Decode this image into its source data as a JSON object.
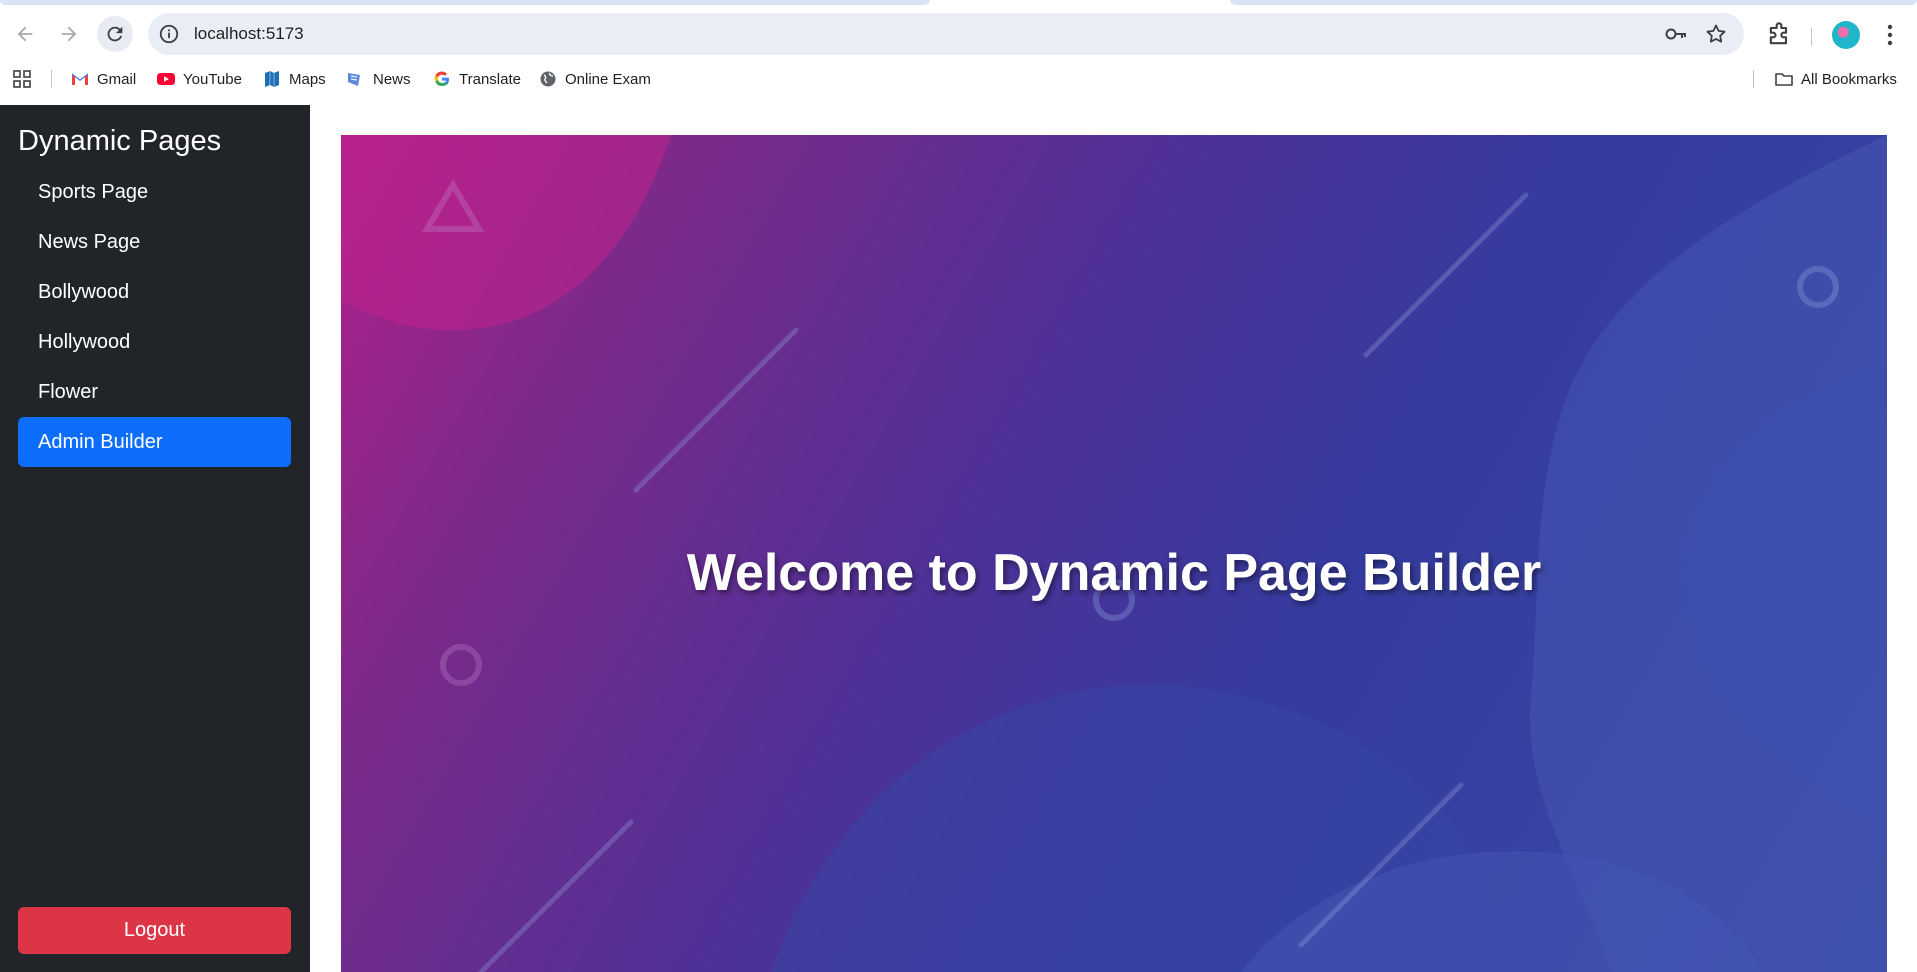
{
  "browser": {
    "url": "localhost:5173",
    "bookmarks": [
      {
        "label": "Gmail",
        "icon": "gmail-icon"
      },
      {
        "label": "YouTube",
        "icon": "youtube-icon"
      },
      {
        "label": "Maps",
        "icon": "maps-icon"
      },
      {
        "label": "News",
        "icon": "news-icon"
      },
      {
        "label": "Translate",
        "icon": "google-icon"
      },
      {
        "label": "Online Exam",
        "icon": "globe-icon"
      }
    ],
    "all_bookmarks_label": "All Bookmarks"
  },
  "sidebar": {
    "brand": "Dynamic Pages",
    "items": [
      {
        "label": "Sports Page",
        "active": false
      },
      {
        "label": "News Page",
        "active": false
      },
      {
        "label": "Bollywood",
        "active": false
      },
      {
        "label": "Hollywood",
        "active": false
      },
      {
        "label": "Flower",
        "active": false
      },
      {
        "label": "Admin Builder",
        "active": true
      }
    ],
    "logout_label": "Logout"
  },
  "main": {
    "hero_title": "Welcome to Dynamic Page Builder"
  },
  "colors": {
    "sidebar_bg": "#212529",
    "active_item": "#0d6efd",
    "logout": "#dc3545",
    "hero_start": "#b0208a",
    "hero_end": "#3a4aa6"
  }
}
